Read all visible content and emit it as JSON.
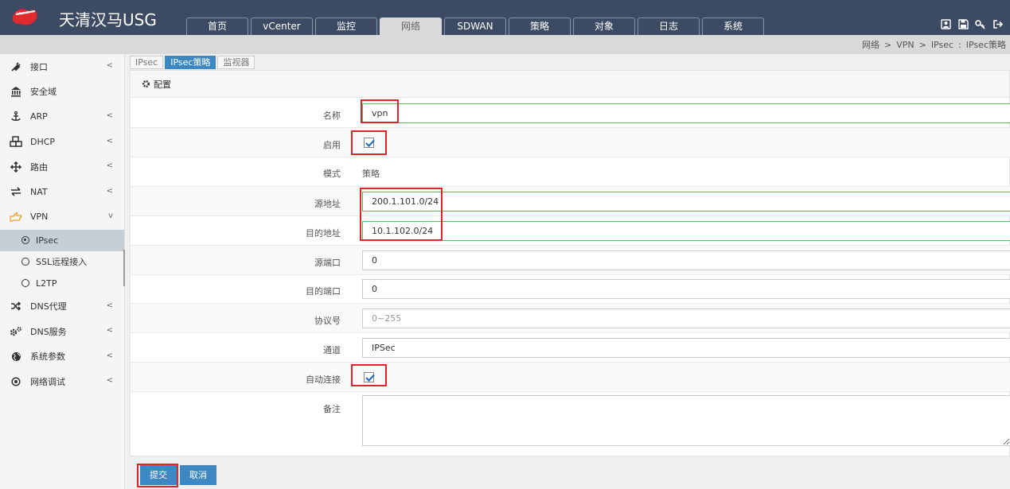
{
  "app": {
    "logo_mark_text": "Venus",
    "title": "天清汉马USG"
  },
  "nav_tabs": [
    {
      "label": "首页",
      "active": false
    },
    {
      "label": "vCenter",
      "active": false
    },
    {
      "label": "监控",
      "active": false
    },
    {
      "label": "网络",
      "active": true
    },
    {
      "label": "SDWAN",
      "active": false
    },
    {
      "label": "策略",
      "active": false
    },
    {
      "label": "对象",
      "active": false
    },
    {
      "label": "日志",
      "active": false
    },
    {
      "label": "系统",
      "active": false
    }
  ],
  "header_icons": [
    "user-icon",
    "save-icon",
    "key-icon",
    "logout-icon"
  ],
  "breadcrumb": {
    "items": [
      "网络",
      "VPN",
      "IPsec",
      "IPsec策略"
    ],
    "sep1": ">",
    "sep2": ">",
    "sep3": ":"
  },
  "sidebar": {
    "items": [
      {
        "label": "接口",
        "icon": "plug-icon",
        "chevron": "<"
      },
      {
        "label": "安全域",
        "icon": "bank-icon",
        "chevron": ""
      },
      {
        "label": "ARP",
        "icon": "anchor-icon",
        "chevron": "<"
      },
      {
        "label": "DHCP",
        "icon": "cubes-icon",
        "chevron": "<"
      },
      {
        "label": "路由",
        "icon": "arrows-icon",
        "chevron": "<"
      },
      {
        "label": "NAT",
        "icon": "exchange-icon",
        "chevron": "<"
      },
      {
        "label": "VPN",
        "icon": "hand-pointer-icon",
        "chevron": "v"
      }
    ],
    "vpn_sub": [
      {
        "label": "IPsec",
        "active": true
      },
      {
        "label": "SSL远程接入",
        "active": false
      },
      {
        "label": "L2TP",
        "active": false
      }
    ],
    "items_after": [
      {
        "label": "DNS代理",
        "icon": "random-icon",
        "chevron": "<"
      },
      {
        "label": "DNS服务",
        "icon": "cogs-icon",
        "chevron": "<"
      },
      {
        "label": "系统参数",
        "icon": "globe-icon",
        "chevron": "<"
      },
      {
        "label": "网络调试",
        "icon": "dot-circle-icon",
        "chevron": "<"
      }
    ]
  },
  "subtabs": [
    {
      "label": "IPsec",
      "active": false
    },
    {
      "label": "IPsec策略",
      "active": true
    },
    {
      "label": "监视器",
      "active": false
    }
  ],
  "panel": {
    "title": "配置"
  },
  "form": {
    "name": {
      "label": "名称",
      "value": "vpn"
    },
    "enable": {
      "label": "启用",
      "checked": true
    },
    "mode": {
      "label": "模式",
      "value": "策略"
    },
    "src_addr": {
      "label": "源地址",
      "value": "200.1.101.0/24"
    },
    "dst_addr": {
      "label": "目的地址",
      "value": "10.1.102.0/24"
    },
    "src_port": {
      "label": "源端口",
      "value": "0"
    },
    "dst_port": {
      "label": "目的端口",
      "value": "0"
    },
    "protocol": {
      "label": "协议号",
      "placeholder": "0~255"
    },
    "tunnel": {
      "label": "通道",
      "value": "IPSec"
    },
    "auto_connect": {
      "label": "自动连接",
      "checked": true
    },
    "remark": {
      "label": "备注",
      "value": ""
    }
  },
  "buttons": {
    "submit": "提交",
    "cancel": "取消"
  },
  "colors": {
    "header_bg": "#3c4b63",
    "accent": "#3d87c2",
    "highlight_box": "#e0242b",
    "valid_border": "#5cb85c"
  }
}
